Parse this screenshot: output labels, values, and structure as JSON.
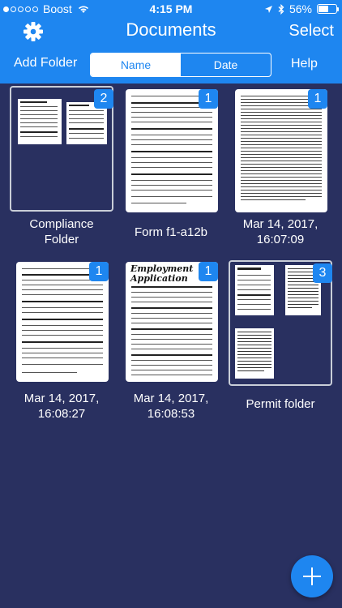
{
  "status_bar": {
    "carrier": "Boost",
    "time": "4:15 PM",
    "battery": "56%",
    "battery_level": 0.56,
    "signal_bars_filled": 1
  },
  "nav": {
    "title": "Documents",
    "select_label": "Select",
    "settings_icon": "gear-icon"
  },
  "toolbar": {
    "add_folder_label": "Add Folder",
    "sort_options": [
      "Name",
      "Date"
    ],
    "selected_sort": "Name",
    "help_label": "Help"
  },
  "items": [
    {
      "kind": "folder",
      "badge": "2",
      "caption_line1": "Compliance",
      "caption_line2": "Folder"
    },
    {
      "kind": "doc",
      "badge": "1",
      "caption_line1": "Form f1-a12b",
      "caption_line2": ""
    },
    {
      "kind": "doc",
      "badge": "1",
      "caption_line1": "Mar 14, 2017,",
      "caption_line2": "16:07:09"
    },
    {
      "kind": "doc",
      "badge": "1",
      "caption_line1": "Mar 14, 2017,",
      "caption_line2": "16:08:27"
    },
    {
      "kind": "doc",
      "badge": "1",
      "caption_line1": "Mar 14, 2017,",
      "caption_line2": "16:08:53"
    },
    {
      "kind": "folder",
      "badge": "3",
      "caption_line1": "Permit folder",
      "caption_line2": ""
    }
  ],
  "thumbnail_text": {
    "employment_title": "Employment",
    "application_title": "Application"
  },
  "colors": {
    "accent": "#1e86f0",
    "background": "#293060"
  },
  "fab": {
    "icon": "plus-icon"
  }
}
